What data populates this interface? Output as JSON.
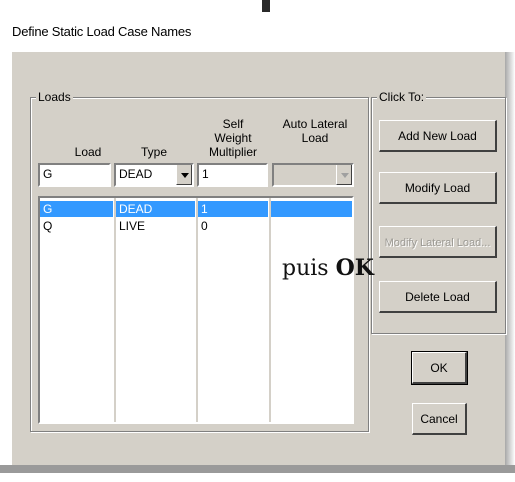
{
  "window": {
    "title": "Define Static Load Case Names"
  },
  "loads_group": {
    "label": "Loads",
    "headers": {
      "load": "Load",
      "type": "Type",
      "self_weight_multiplier": "Self Weight Multiplier",
      "auto_lateral_load": "Auto Lateral Load"
    },
    "inputs": {
      "load": "G",
      "type": "DEAD",
      "multiplier": "1",
      "auto_lateral": ""
    },
    "rows": [
      {
        "load": "G",
        "type": "DEAD",
        "multiplier": "1",
        "auto_lateral": "",
        "selected": true
      },
      {
        "load": "Q",
        "type": "LIVE",
        "multiplier": "0",
        "auto_lateral": "",
        "selected": false
      }
    ]
  },
  "click_group": {
    "label": "Click To:",
    "buttons": {
      "add": "Add New Load",
      "modify": "Modify Load",
      "modify_lateral": "Modify Lateral Load...",
      "delete": "Delete Load"
    }
  },
  "dialog_buttons": {
    "ok": "OK",
    "cancel": "Cancel"
  },
  "annotation": {
    "text": "puis ",
    "bold": "OK"
  },
  "colors": {
    "dialog_bg": "#d4d0c8",
    "selection": "#3399ff"
  }
}
